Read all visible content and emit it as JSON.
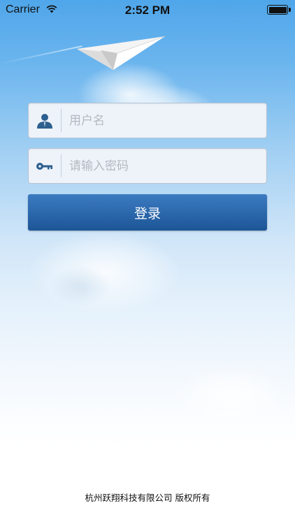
{
  "status_bar": {
    "carrier": "Carrier",
    "time": "2:52 PM",
    "wifi_icon": "wifi-icon",
    "battery_icon": "battery-icon"
  },
  "login_form": {
    "username": {
      "value": "",
      "placeholder": "用户名",
      "icon": "user-icon"
    },
    "password": {
      "value": "",
      "placeholder": "请输入密码",
      "icon": "key-icon"
    },
    "submit_label": "登录",
    "accent_color": "#2a66aa"
  },
  "footer": {
    "copyright": "杭州跃翔科技有限公司 版权所有"
  }
}
